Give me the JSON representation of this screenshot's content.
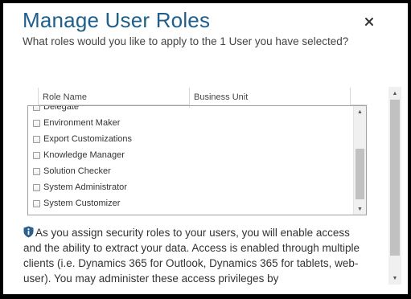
{
  "dialog": {
    "title": "Manage User Roles",
    "subtitle": "What roles would you like to apply to the 1 User you have selected?",
    "close_glyph": "×"
  },
  "table": {
    "columns": {
      "role_name": "Role Name",
      "business_unit": "Business Unit"
    },
    "rows": [
      {
        "label": "Delegate",
        "checked": false
      },
      {
        "label": "Environment Maker",
        "checked": false
      },
      {
        "label": "Export Customizations",
        "checked": false
      },
      {
        "label": "Knowledge Manager",
        "checked": false
      },
      {
        "label": "Solution Checker",
        "checked": false
      },
      {
        "label": "System Administrator",
        "checked": false
      },
      {
        "label": "System Customizer",
        "checked": false
      }
    ]
  },
  "notice": {
    "icon": "info-shield-icon",
    "text": "As you assign security roles to your users, you will enable access and the ability to extract your data. Access is enabled through multiple clients (i.e. Dynamics 365 for Outlook, Dynamics 365 for tablets, web-user). You may administer these access privileges by"
  },
  "colors": {
    "title": "#1f5f8c",
    "icon": "#2b5f8c",
    "border": "#000000"
  }
}
